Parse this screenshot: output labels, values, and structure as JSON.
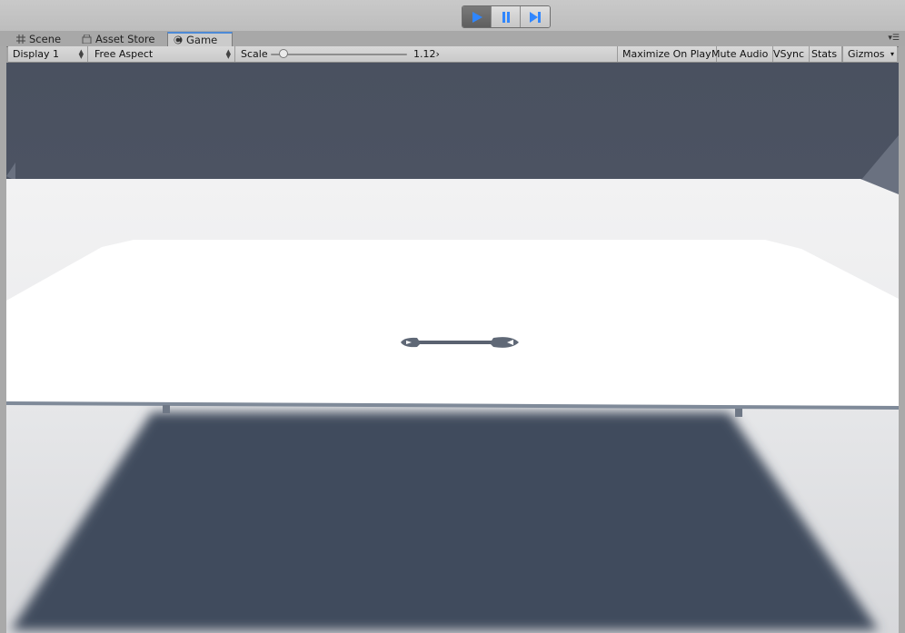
{
  "playbar": {
    "buttons": [
      {
        "name": "play",
        "icon": "play-icon",
        "active": true
      },
      {
        "name": "pause",
        "icon": "pause-icon",
        "active": false
      },
      {
        "name": "step",
        "icon": "step-icon",
        "active": false
      }
    ],
    "accent": "#2f86ff"
  },
  "tabs": {
    "scene": "Scene",
    "asset_store": "Asset Store",
    "game": "Game",
    "active": "Game"
  },
  "toolbar": {
    "display": "Display 1",
    "aspect": "Free Aspect",
    "scale_label": "Scale",
    "scale_value": "1.12›",
    "scale_fraction": 0.09,
    "maximize_on_play": "Maximize On Play",
    "mute_audio": "Mute Audio",
    "vsync": "VSync",
    "stats": "Stats",
    "gizmos": "Gizmos"
  },
  "colors": {
    "sky": "#4e5563",
    "shadow": "#414c5d",
    "ground": "#e8e9ea",
    "table_top": "#ffffff"
  }
}
